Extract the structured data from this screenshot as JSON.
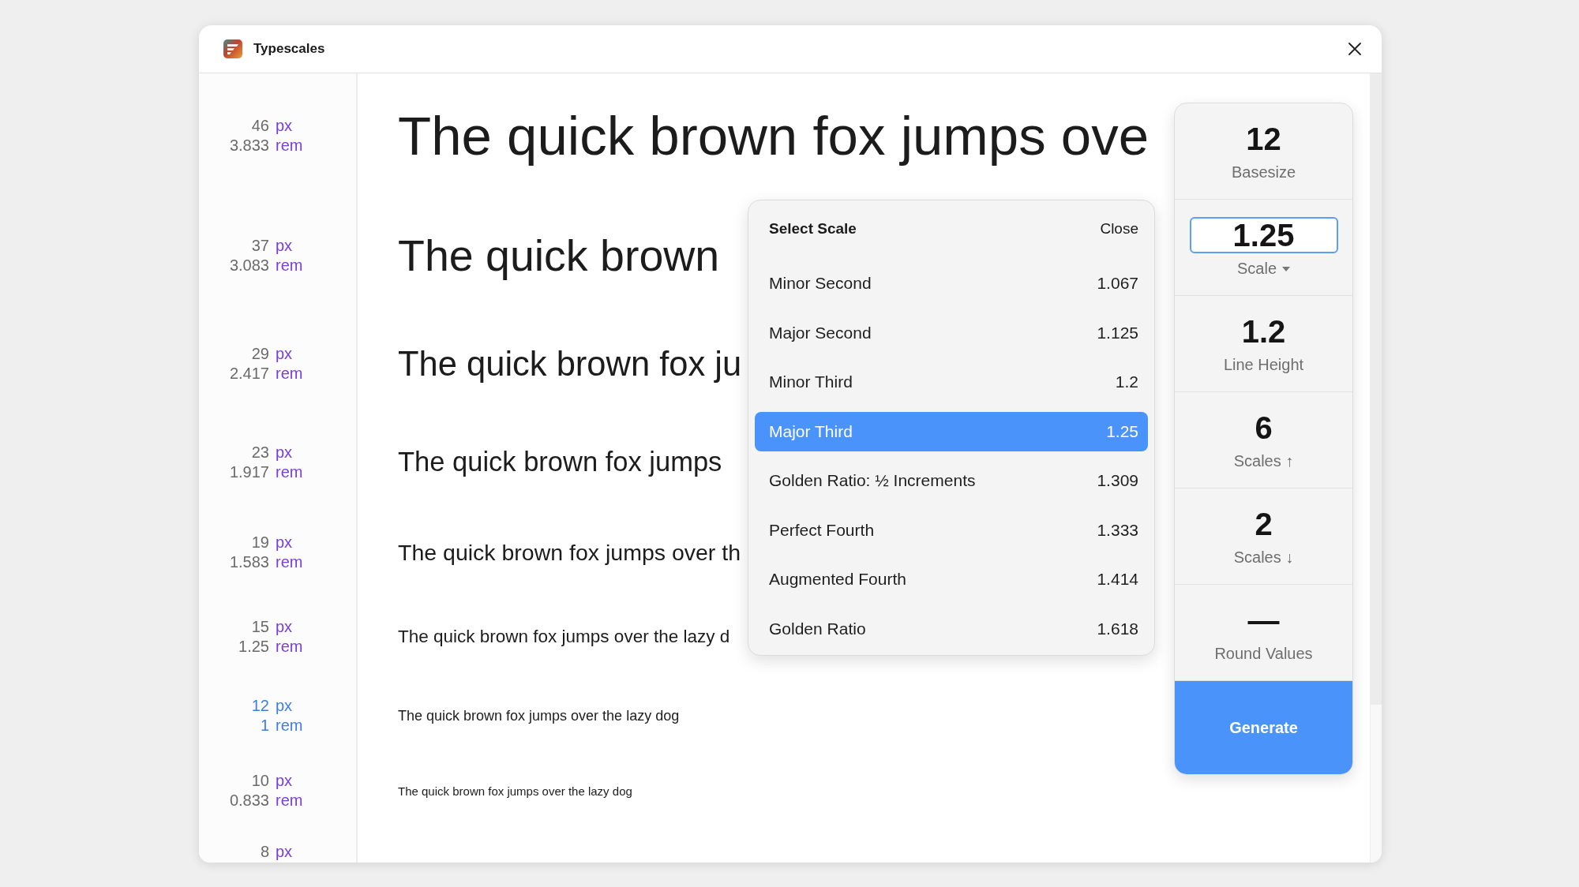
{
  "window": {
    "title": "Typescales"
  },
  "scale_rows": [
    {
      "px": "46",
      "px_label": "px",
      "rem": "3.833",
      "rem_label": "rem",
      "base": false,
      "sample": "The quick brown fox jumps ove"
    },
    {
      "px": "37",
      "px_label": "px",
      "rem": "3.083",
      "rem_label": "rem",
      "base": false,
      "sample": "The quick brown"
    },
    {
      "px": "29",
      "px_label": "px",
      "rem": "2.417",
      "rem_label": "rem",
      "base": false,
      "sample": "The quick brown fox ju"
    },
    {
      "px": "23",
      "px_label": "px",
      "rem": "1.917",
      "rem_label": "rem",
      "base": false,
      "sample": "The quick brown fox jumps"
    },
    {
      "px": "19",
      "px_label": "px",
      "rem": "1.583",
      "rem_label": "rem",
      "base": false,
      "sample": "The quick brown fox jumps over th"
    },
    {
      "px": "15",
      "px_label": "px",
      "rem": "1.25",
      "rem_label": "rem",
      "base": false,
      "sample": "The quick brown fox jumps over the lazy d"
    },
    {
      "px": "12",
      "px_label": "px",
      "rem": "1",
      "rem_label": "rem",
      "base": true,
      "sample": "The quick brown fox jumps over the lazy dog"
    },
    {
      "px": "10",
      "px_label": "px",
      "rem": "0.833",
      "rem_label": "rem",
      "base": false,
      "sample": "The quick brown fox jumps over the lazy dog"
    },
    {
      "px": "8",
      "px_label": "px",
      "base": false
    }
  ],
  "scale_menu": {
    "title": "Select Scale",
    "close": "Close",
    "options": [
      {
        "name": "Minor Second",
        "ratio": "1.067",
        "selected": false
      },
      {
        "name": "Major Second",
        "ratio": "1.125",
        "selected": false
      },
      {
        "name": "Minor Third",
        "ratio": "1.2",
        "selected": false
      },
      {
        "name": "Major Third",
        "ratio": "1.25",
        "selected": true
      },
      {
        "name": "Golden Ratio: ½ Increments",
        "ratio": "1.309",
        "selected": false
      },
      {
        "name": "Perfect Fourth",
        "ratio": "1.333",
        "selected": false
      },
      {
        "name": "Augmented Fourth",
        "ratio": "1.414",
        "selected": false
      },
      {
        "name": "Golden Ratio",
        "ratio": "1.618",
        "selected": false
      }
    ]
  },
  "settings": [
    {
      "kind": "value",
      "value": "12",
      "label": "Basesize"
    },
    {
      "kind": "select",
      "value": "1.25",
      "label": "Scale"
    },
    {
      "kind": "value",
      "value": "1.2",
      "label": "Line Height"
    },
    {
      "kind": "value",
      "value": "6",
      "label": "Scales ↑"
    },
    {
      "kind": "value",
      "value": "2",
      "label": "Scales ↓"
    },
    {
      "kind": "value",
      "value": "—",
      "label": "Round Values"
    }
  ],
  "generate_button": "Generate"
}
